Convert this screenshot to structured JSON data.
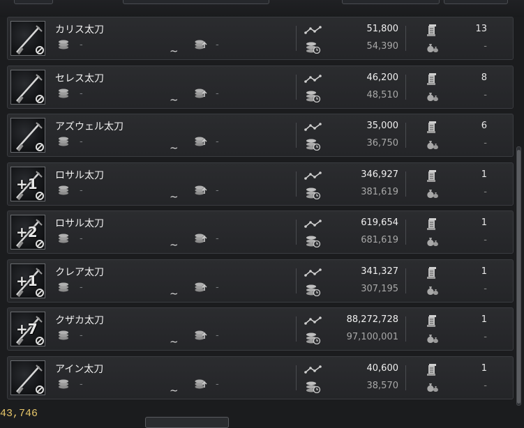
{
  "range_separator": "~",
  "empty_value": "-",
  "footer": {
    "silver": "43,746"
  },
  "items": [
    {
      "name": "カリス太刀",
      "enhance": "",
      "price": "51,800",
      "prev_price": "54,390",
      "count": "13",
      "pending": "-"
    },
    {
      "name": "セレス太刀",
      "enhance": "",
      "price": "46,200",
      "prev_price": "48,510",
      "count": "8",
      "pending": "-"
    },
    {
      "name": "アズウェル太刀",
      "enhance": "",
      "price": "35,000",
      "prev_price": "36,750",
      "count": "6",
      "pending": "-"
    },
    {
      "name": "ロサル太刀",
      "enhance": "+1",
      "price": "346,927",
      "prev_price": "381,619",
      "count": "1",
      "pending": "-"
    },
    {
      "name": "ロサル太刀",
      "enhance": "+2",
      "price": "619,654",
      "prev_price": "681,619",
      "count": "1",
      "pending": "-"
    },
    {
      "name": "クレア太刀",
      "enhance": "+1",
      "price": "341,327",
      "prev_price": "307,195",
      "count": "1",
      "pending": "-"
    },
    {
      "name": "クザカ太刀",
      "enhance": "+7",
      "price": "88,272,728",
      "prev_price": "97,100,001",
      "count": "1",
      "pending": "-"
    },
    {
      "name": "アイン太刀",
      "enhance": "",
      "price": "40,600",
      "prev_price": "38,570",
      "count": "1",
      "pending": "-"
    }
  ],
  "icons": {
    "item": "katana-icon",
    "sealed": "sealed-icon",
    "min_price": "coin-stack-icon",
    "max_price": "coin-stack-up-icon",
    "trend": "price-trend-icon",
    "history": "coin-history-icon",
    "stock": "scroll-icon",
    "pending": "money-bag-icon"
  },
  "colors": {
    "background": "#1b1c1e",
    "row": "#2a2b2e",
    "silver": "#e8c76a",
    "muted": "#a8a8a8"
  }
}
